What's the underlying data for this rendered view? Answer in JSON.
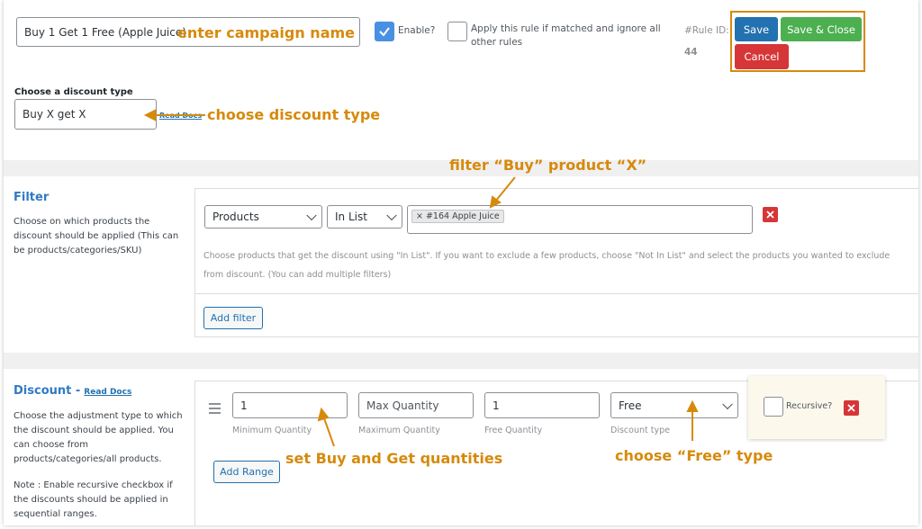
{
  "header": {
    "campaign_name_value": "Buy 1 Get 1 Free (Apple Juice)",
    "enable_label": "Enable?",
    "apply_rule_label": "Apply this rule if matched and ignore all other rules",
    "rule_id_label": "#Rule ID:",
    "rule_id_value": "44",
    "save_label": "Save",
    "save_close_label": "Save & Close",
    "cancel_label": "Cancel"
  },
  "discount_type": {
    "label": "Choose a discount type",
    "selected": "Buy X get X",
    "read_docs": "Read Docs"
  },
  "filter": {
    "title": "Filter",
    "description": "Choose on which products the discount should be applied (This can be products/categories/SKU)",
    "type_selected": "Products",
    "condition_selected": "In List",
    "tag_value": "#164 Apple Juice",
    "tag_remove": "×",
    "help_text": "Choose products that get the discount using \"In List\". If you want to exclude a few products, choose \"Not In List\" and select the products you wanted to exclude from discount. (You can add multiple filters)",
    "add_filter_label": "Add filter"
  },
  "discount": {
    "title": "Discount -",
    "read_docs": "Read Docs",
    "description": "Choose the adjustment type to which the discount should be applied. You can choose from products/categories/all products.",
    "note": "Note : Enable recursive checkbox if the discounts should be applied in sequential ranges.",
    "min_qty_value": "1",
    "min_qty_caption": "Minimum Quantity",
    "max_qty_placeholder": "Max Quantity",
    "max_qty_caption": "Maximum Quantity",
    "free_qty_value": "1",
    "free_qty_caption": "Free Quantity",
    "discount_type_selected": "Free",
    "discount_type_caption": "Discount type",
    "recursive_label": "Recursive?",
    "add_range_label": "Add Range"
  },
  "annotations": {
    "campaign": "enter campaign name",
    "discount_type": "choose discount type",
    "filter_product": "filter “Buy” product “X”",
    "quantities": "set Buy and Get quantities",
    "free_type": "choose “Free” type"
  },
  "colors": {
    "annotation": "#d68a0c",
    "save": "#2271b1",
    "save_close": "#4caf50",
    "cancel": "#d63638",
    "section_title": "#2f7ac4"
  }
}
